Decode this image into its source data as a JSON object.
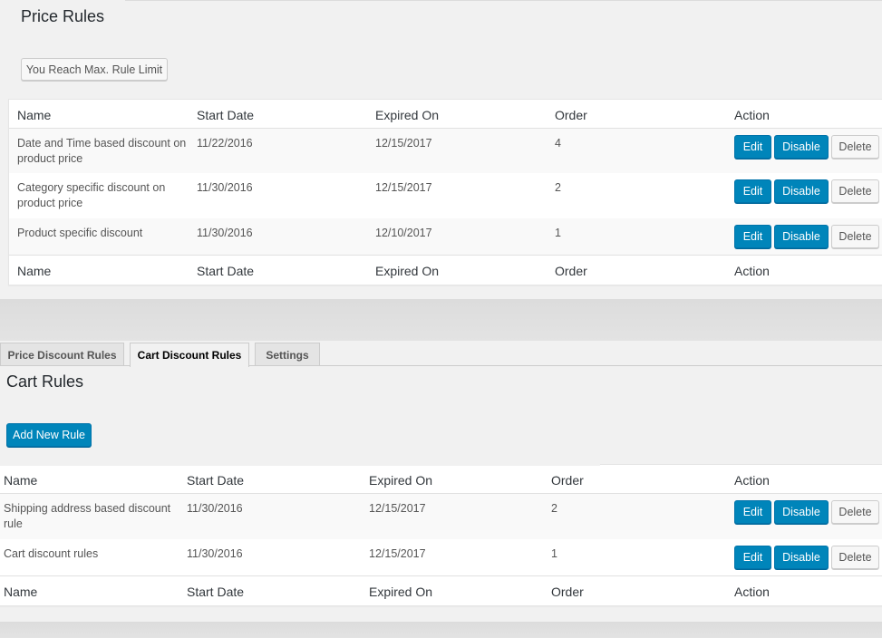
{
  "price_panel": {
    "title": "Price Rules",
    "limit_button": "You Reach Max. Rule Limit",
    "columns": [
      "Name",
      "Start Date",
      "Expired On",
      "Order",
      "Action"
    ],
    "rows": [
      {
        "name_line1": "Date and Time based discount on",
        "name_line2": "product price",
        "start": "11/22/2016",
        "expires": "12/15/2017",
        "order": "4"
      },
      {
        "name_line1": "Category specific discount on",
        "name_line2": "product price",
        "start": "11/30/2016",
        "expires": "12/15/2017",
        "order": "2"
      },
      {
        "name_line1": "Product specific discount",
        "name_line2": "",
        "start": "11/30/2016",
        "expires": "12/10/2017",
        "order": "1"
      }
    ]
  },
  "actions": {
    "edit": "Edit",
    "disable": "Disable",
    "delete": "Delete"
  },
  "tabs": [
    {
      "label": "Price Discount Rules",
      "active": false
    },
    {
      "label": "Cart Discount Rules",
      "active": true
    },
    {
      "label": "Settings",
      "active": false
    }
  ],
  "cart_panel": {
    "title": "Cart Rules",
    "add_button": "Add New Rule",
    "columns": [
      "Name",
      "Start Date",
      "Expired On",
      "Order",
      "Action"
    ],
    "rows": [
      {
        "name_line1": "Shipping address based discount",
        "name_line2": "rule",
        "start": "11/30/2016",
        "expires": "12/15/2017",
        "order": "2"
      },
      {
        "name_line1": "Cart discount rules",
        "name_line2": "",
        "start": "11/30/2016",
        "expires": "12/15/2017",
        "order": "1"
      }
    ]
  },
  "colors": {
    "primary": "#0085ba",
    "background": "#f1f1f1",
    "band": "#dcdcdc"
  }
}
